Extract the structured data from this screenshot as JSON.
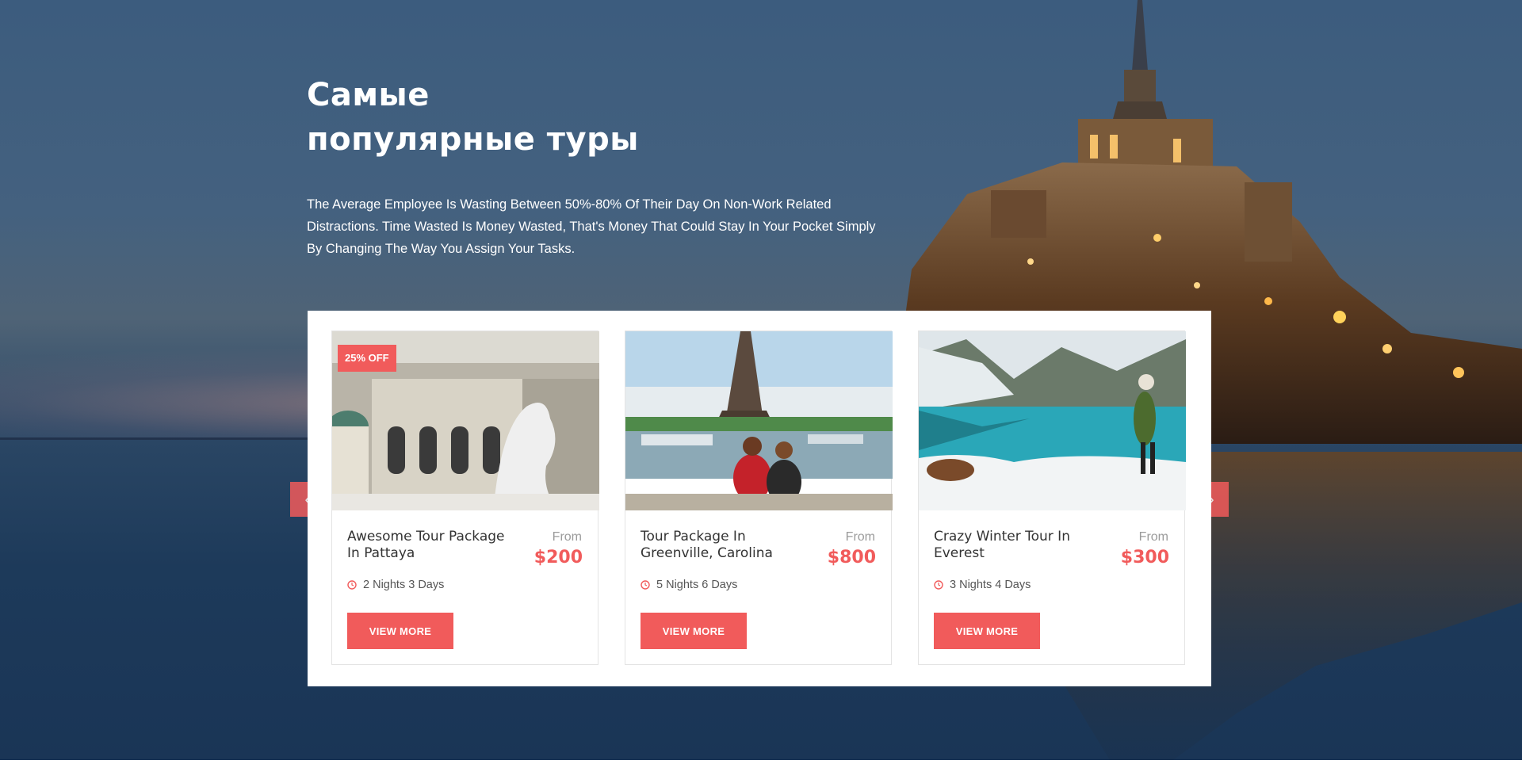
{
  "hero": {
    "title_line1": "Самые",
    "title_line2": "популярные туры",
    "description": "The Average Employee Is Wasting Between 50%-80% Of Their Day On Non-Work Related Distractions. Time Wasted Is Money Wasted, That's Money That Could Stay In Your Pocket Simply By Changing The Way You Assign Your Tasks."
  },
  "slider": {
    "prev_icon": "chevron-left-icon",
    "next_icon": "chevron-right-icon",
    "prev_label": "‹",
    "next_label": "›"
  },
  "tours": [
    {
      "badge": "25% OFF",
      "name": "Awesome Tour Package In Pattaya",
      "from_label": "From",
      "price": "$200",
      "duration": "2 Nights 3 Days",
      "button": "VIEW MORE",
      "image": "palace-with-horse-statue"
    },
    {
      "name": "Tour Package In Greenville, Carolina",
      "from_label": "From",
      "price": "$800",
      "duration": "5 Nights 6 Days",
      "button": "VIEW MORE",
      "image": "eiffel-tower-two-women"
    },
    {
      "name": "Crazy Winter Tour In Everest",
      "from_label": "From",
      "price": "$300",
      "duration": "3 Nights 4 Days",
      "button": "VIEW MORE",
      "image": "mountain-lake-snow"
    }
  ],
  "colors": {
    "accent": "#f15b5b",
    "text_dark": "#333333",
    "text_muted": "#9b9b9b"
  }
}
